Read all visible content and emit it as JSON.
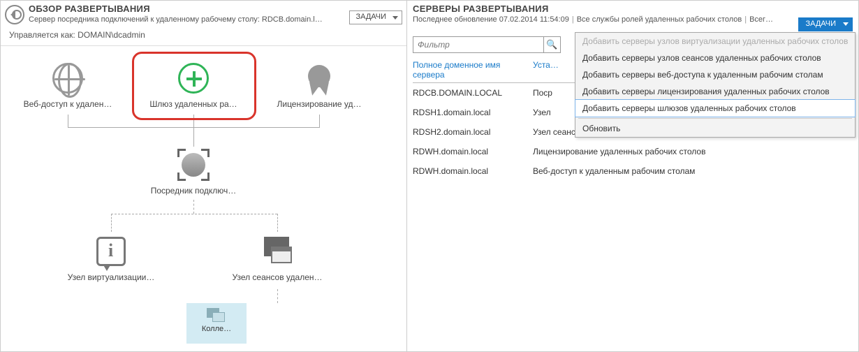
{
  "left": {
    "title": "ОБЗОР РАЗВЕРТЫВАНИЯ",
    "subtitle": "Сервер посредника подключений к удаленному рабочему столу: RDCB.domain.l…",
    "tasks_label": "ЗАДАЧИ",
    "managed_as": "Управляется как: DOMAIN\\dcadmin",
    "nodes": {
      "web": "Веб-доступ к удален…",
      "gateway": "Шлюз удаленных ра…",
      "licensing": "Лицензирование уд…",
      "broker": "Посредник подключ…",
      "virt": "Узел виртуализации…",
      "session": "Узел сеансов удален…",
      "collection": "Колле…"
    }
  },
  "right": {
    "title": "СЕРВЕРЫ РАЗВЕРТЫВАНИЯ",
    "sub_updated": "Последнее обновление 07.02.2014 11:54:09",
    "sub_roles": "Все службы ролей удаленных рабочих столов",
    "sub_total": "Всег…",
    "tasks_label": "ЗАДАЧИ",
    "filter_placeholder": "Фильтр",
    "th_server": "Полное доменное имя сервера",
    "th_role": "Уста…",
    "rows": [
      {
        "server": "RDCB.DOMAIN.LOCAL",
        "role": "Поср"
      },
      {
        "server": "RDSH1.domain.local",
        "role": "Узел"
      },
      {
        "server": "RDSH2.domain.local",
        "role": "Узел сеансов удаленных рабочих столов"
      },
      {
        "server": "RDWH.domain.local",
        "role": "Лицензирование удаленных рабочих столов"
      },
      {
        "server": "RDWH.domain.local",
        "role": "Веб-доступ к удаленным рабочим столам"
      }
    ],
    "menu": {
      "add_virt": "Добавить серверы узлов виртуализации удаленных рабочих столов",
      "add_session": "Добавить серверы узлов сеансов удаленных рабочих столов",
      "add_web": "Добавить серверы веб-доступа к удаленным рабочим столам",
      "add_lic": "Добавить серверы лицензирования удаленных рабочих столов",
      "add_gw": "Добавить серверы шлюзов удаленных рабочих столов",
      "refresh": "Обновить"
    }
  }
}
